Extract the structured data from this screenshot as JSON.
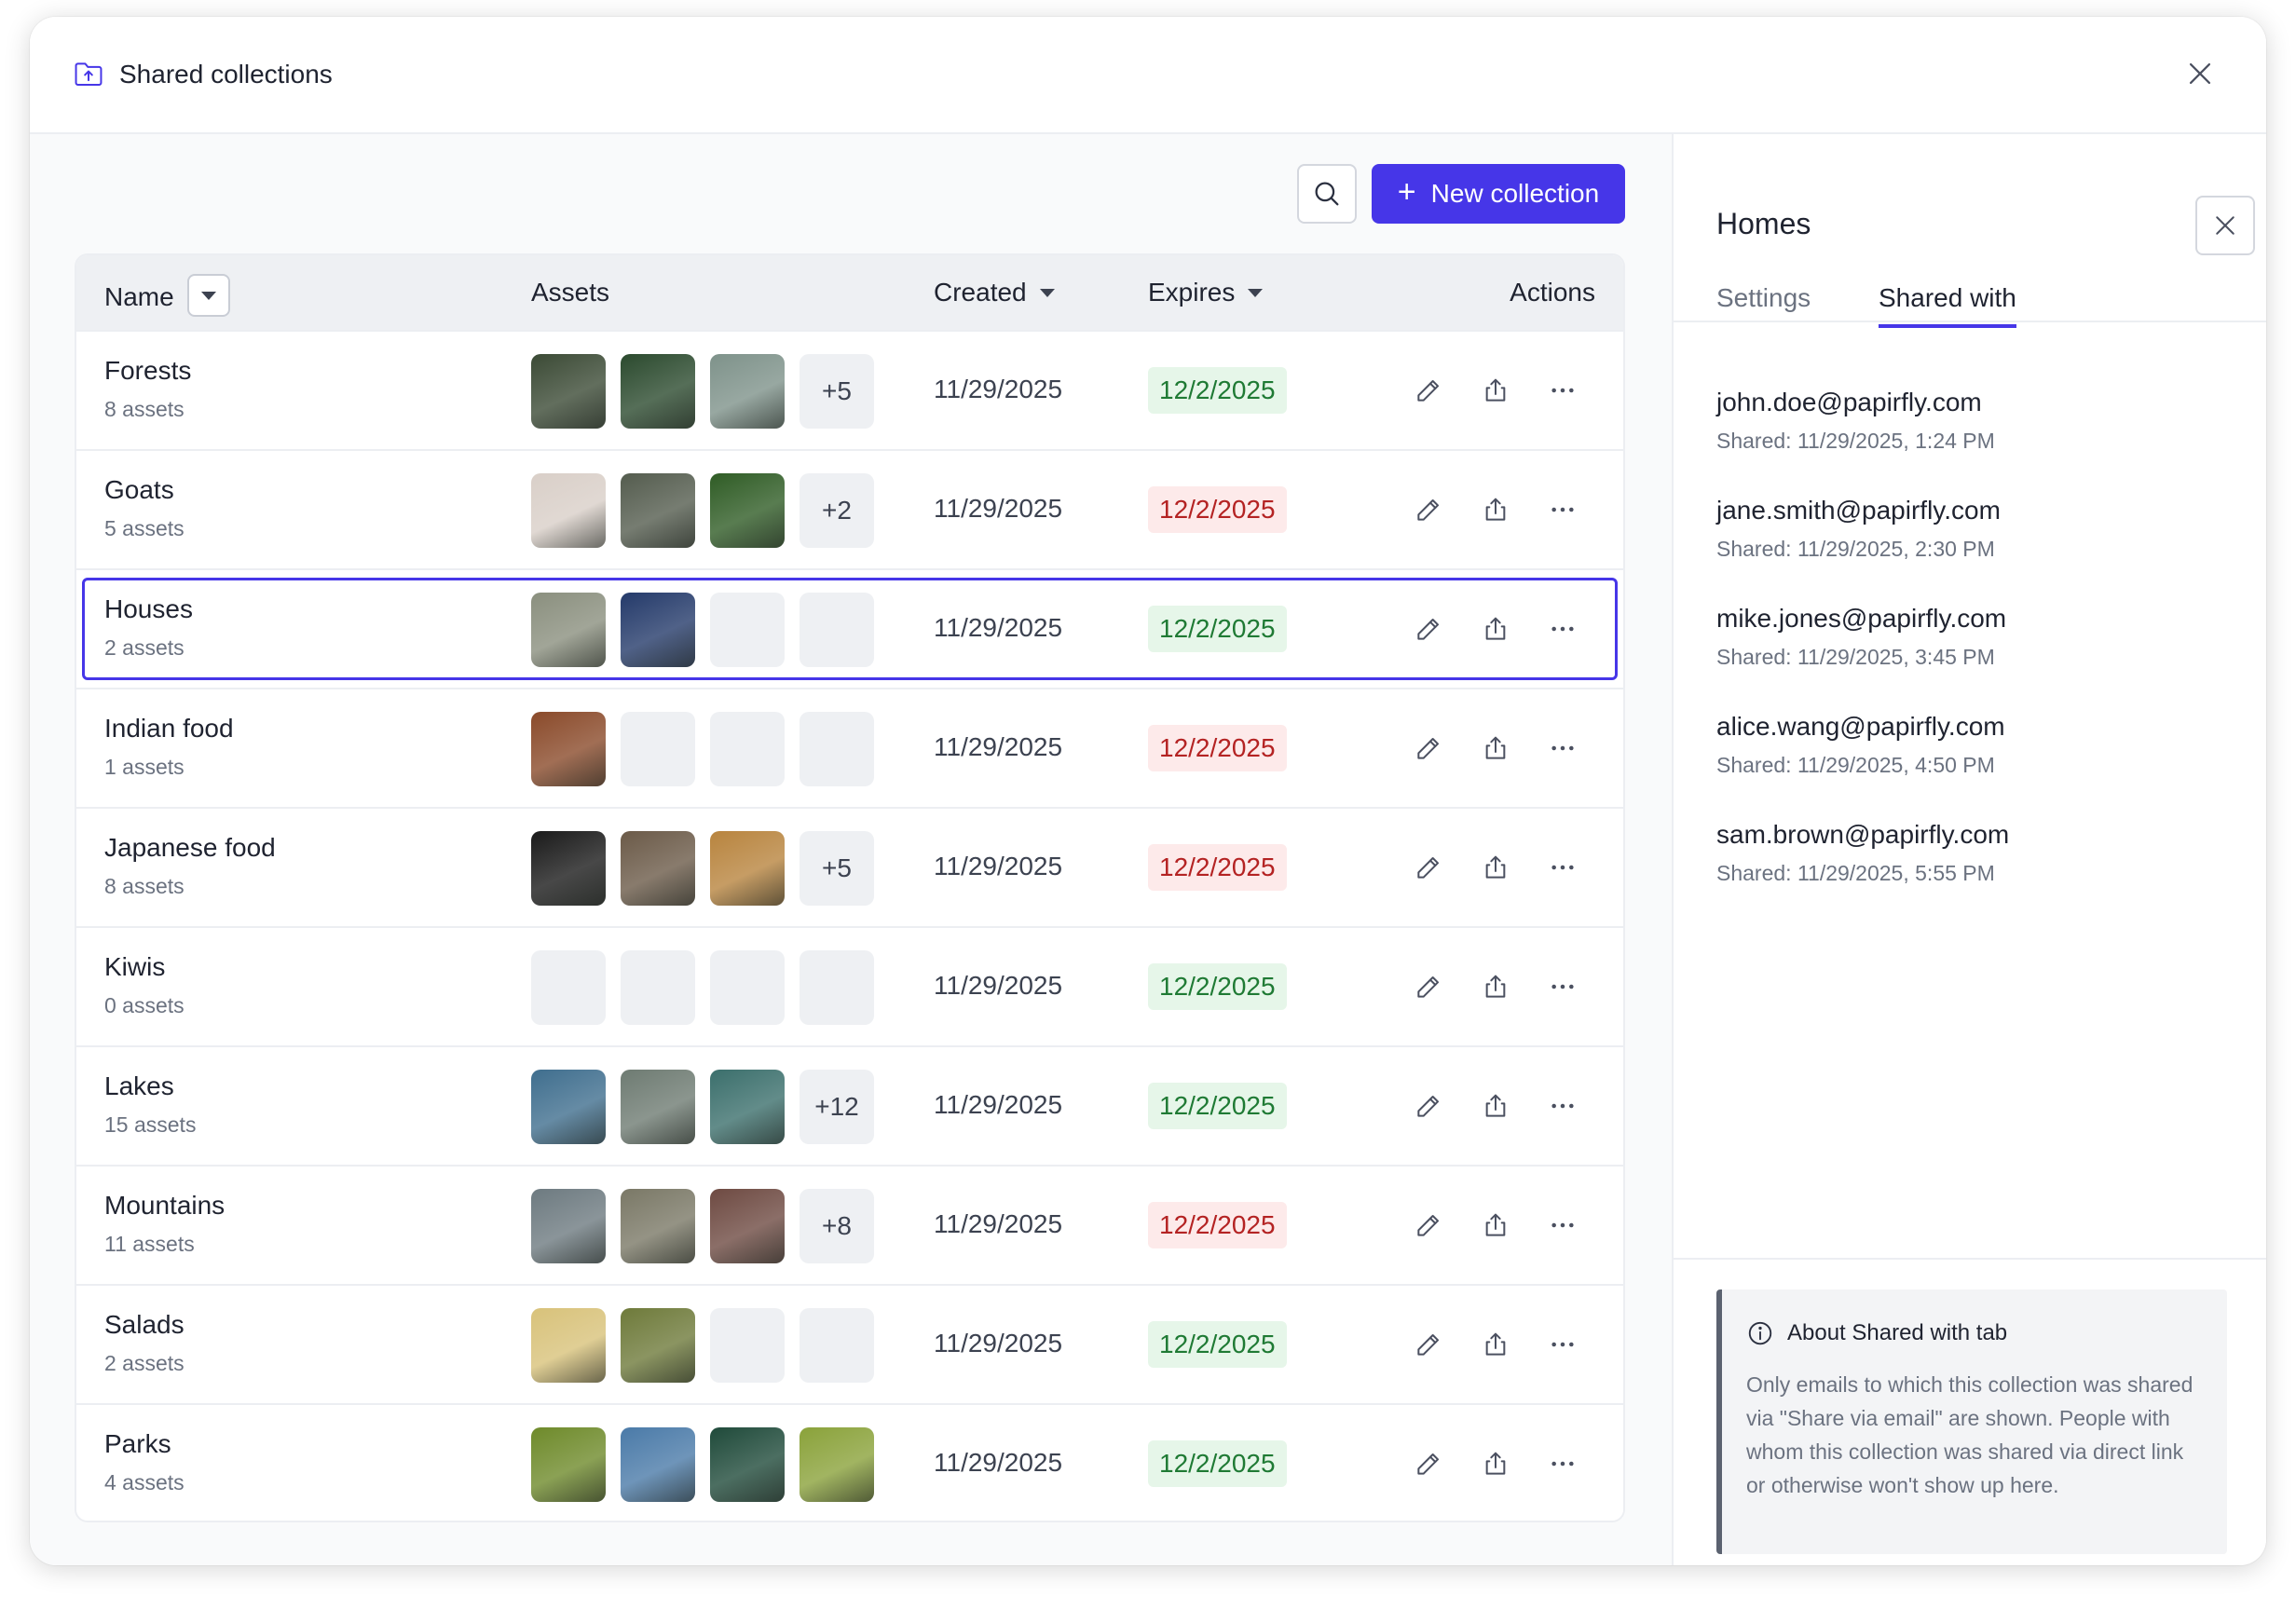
{
  "dialog": {
    "title": "Shared collections"
  },
  "toolbar": {
    "new_label": "New collection"
  },
  "table": {
    "headers": {
      "name": "Name",
      "assets": "Assets",
      "created": "Created",
      "expires": "Expires",
      "actions": "Actions"
    },
    "rows": [
      {
        "name": "Forests",
        "count": "8 assets",
        "thumbs": [
          "#3b4a35",
          "#2b4a2e",
          "#7e928a"
        ],
        "more": "+5",
        "created": "11/29/2025",
        "expires": "12/2/2025",
        "status": "green",
        "selected": false
      },
      {
        "name": "Goats",
        "count": "5 assets",
        "thumbs": [
          "#d9cfc8",
          "#545c4e",
          "#2f5c25"
        ],
        "more": "+2",
        "created": "11/29/2025",
        "expires": "12/2/2025",
        "status": "red",
        "selected": false
      },
      {
        "name": "Houses",
        "count": "2 assets",
        "thumbs": [
          "#8a8f7e",
          "#243a6a"
        ],
        "more": "",
        "created": "11/29/2025",
        "expires": "12/2/2025",
        "status": "green",
        "selected": true
      },
      {
        "name": "Indian food",
        "count": "1 assets",
        "thumbs": [
          "#8a4a2a"
        ],
        "more": "",
        "created": "11/29/2025",
        "expires": "12/2/2025",
        "status": "red",
        "selected": false
      },
      {
        "name": "Japanese food",
        "count": "8 assets",
        "thumbs": [
          "#1a1a1a",
          "#6b5a48",
          "#b8843e"
        ],
        "more": "+5",
        "created": "11/29/2025",
        "expires": "12/2/2025",
        "status": "red",
        "selected": false
      },
      {
        "name": "Kiwis",
        "count": "0 assets",
        "thumbs": [],
        "more": "",
        "created": "11/29/2025",
        "expires": "12/2/2025",
        "status": "green",
        "selected": false
      },
      {
        "name": "Lakes",
        "count": "15 assets",
        "thumbs": [
          "#3f6e8e",
          "#6e7b72",
          "#3b6f6c"
        ],
        "more": "+12",
        "created": "11/29/2025",
        "expires": "12/2/2025",
        "status": "green",
        "selected": false
      },
      {
        "name": "Mountains",
        "count": "11 assets",
        "thumbs": [
          "#6d7a80",
          "#7a7866",
          "#6e4a42"
        ],
        "more": "+8",
        "created": "11/29/2025",
        "expires": "12/2/2025",
        "status": "red",
        "selected": false
      },
      {
        "name": "Salads",
        "count": "2 assets",
        "thumbs": [
          "#d8c27a",
          "#6e7a3a"
        ],
        "more": "",
        "created": "11/29/2025",
        "expires": "12/2/2025",
        "status": "green",
        "selected": false
      },
      {
        "name": "Parks",
        "count": "4 assets",
        "thumbs": [
          "#6e8a2a",
          "#4a7aa8",
          "#1f4a3a",
          "#8aa23a"
        ],
        "more": "",
        "created": "11/29/2025",
        "expires": "12/2/2025",
        "status": "green",
        "selected": false
      }
    ]
  },
  "panel": {
    "title": "Homes",
    "tabs": [
      "Settings",
      "Shared with"
    ],
    "active_tab": "Shared with",
    "shares": [
      {
        "email": "john.doe@papirfly.com",
        "date": "Shared: 11/29/2025, 1:24 PM"
      },
      {
        "email": "jane.smith@papirfly.com",
        "date": "Shared: 11/29/2025, 2:30 PM"
      },
      {
        "email": "mike.jones@papirfly.com",
        "date": "Shared: 11/29/2025, 3:45 PM"
      },
      {
        "email": "alice.wang@papirfly.com",
        "date": "Shared: 11/29/2025, 4:50 PM"
      },
      {
        "email": "sam.brown@papirfly.com",
        "date": "Shared: 11/29/2025, 5:55 PM"
      }
    ],
    "info": {
      "title": "About Shared with tab",
      "body": "Only emails to which this collection was shared via \"Share via email\" are shown. People with whom this collection was shared via direct link or otherwise won't show up here."
    }
  },
  "colors": {
    "accent": "#4636e8",
    "expires_green_bg": "#e6f6e9",
    "expires_green_text": "#1f7a34",
    "expires_red_bg": "#fdeaea",
    "expires_red_text": "#b42323"
  }
}
